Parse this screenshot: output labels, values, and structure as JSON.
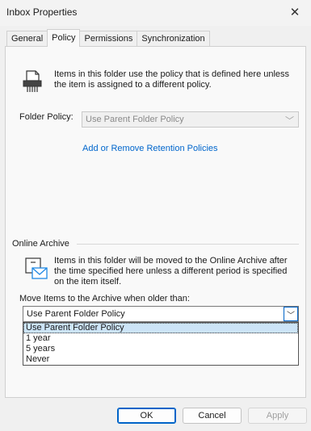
{
  "window": {
    "title": "Inbox Properties",
    "close_glyph": "✕"
  },
  "tabs": [
    {
      "label": "General"
    },
    {
      "label": "Policy"
    },
    {
      "label": "Permissions"
    },
    {
      "label": "Synchronization"
    }
  ],
  "policy": {
    "description": "Items in this folder use the policy that is defined here unless the item is assigned to a different policy.",
    "folder_policy_label": "Folder Policy:",
    "folder_policy_value": "Use Parent Folder Policy",
    "retention_link": "Add or Remove Retention Policies",
    "icon": "shredder-icon"
  },
  "online_archive": {
    "section_label": "Online Archive",
    "description": "Items in this folder will be moved to the Online Archive after the time specified here unless a different period is specified on the item itself.",
    "icon": "mail-archive-icon",
    "move_label": "Move Items to the Archive when older than:",
    "selected_value": "Use Parent Folder Policy",
    "options": [
      {
        "label": "Use Parent Folder Policy"
      },
      {
        "label": "1 year"
      },
      {
        "label": "5 years"
      },
      {
        "label": "Never"
      }
    ]
  },
  "buttons": {
    "ok": "OK",
    "cancel": "Cancel",
    "apply": "Apply"
  },
  "colors": {
    "link": "#0066cc",
    "accent": "#0064c8",
    "selection": "#cce4f7"
  }
}
